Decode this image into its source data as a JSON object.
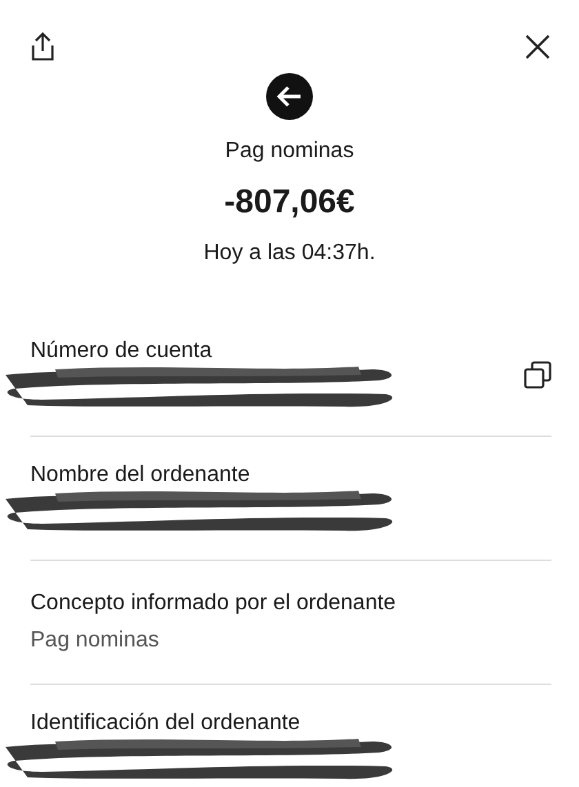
{
  "header": {
    "title": "Pag nominas",
    "amount": "-807,06€",
    "date": "Hoy a las 04:37h."
  },
  "fields": [
    {
      "label": "Número de cuenta",
      "redacted": true,
      "copyable": true
    },
    {
      "label": "Nombre del ordenante",
      "redacted": true,
      "copyable": false
    },
    {
      "label": "Concepto informado por el ordenante",
      "value": "Pag nominas",
      "redacted": false,
      "copyable": false
    },
    {
      "label": "Identificación del ordenante",
      "redacted": true,
      "copyable": false
    }
  ]
}
